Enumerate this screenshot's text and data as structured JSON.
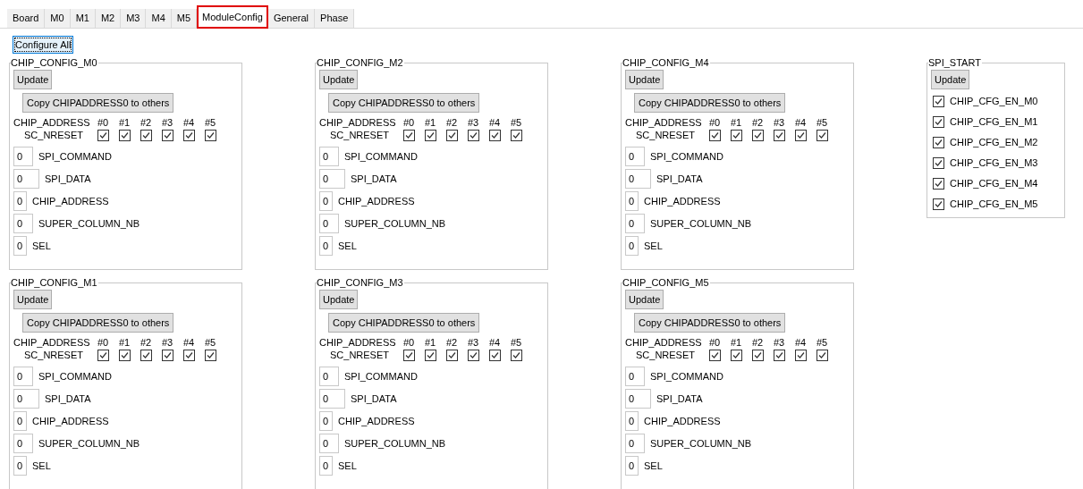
{
  "tabs": [
    {
      "label": "Board",
      "selected": false
    },
    {
      "label": "M0",
      "selected": false
    },
    {
      "label": "M1",
      "selected": false
    },
    {
      "label": "M2",
      "selected": false
    },
    {
      "label": "M3",
      "selected": false
    },
    {
      "label": "M4",
      "selected": false
    },
    {
      "label": "M5",
      "selected": false
    },
    {
      "label": "ModuleConfig",
      "selected": true
    },
    {
      "label": "General",
      "selected": false
    },
    {
      "label": "Phase",
      "selected": false
    }
  ],
  "configure_all": "Configure All",
  "groups": [
    {
      "title": "CHIP_CONFIG_M0",
      "update": "Update",
      "copy": "Copy CHIPADDRESS0 to others",
      "address_label": "CHIP_ADDRESS",
      "reset_label": "SC_NRESET",
      "chips": [
        {
          "label": "#0",
          "checked": true
        },
        {
          "label": "#1",
          "checked": true
        },
        {
          "label": "#2",
          "checked": true
        },
        {
          "label": "#3",
          "checked": true
        },
        {
          "label": "#4",
          "checked": true
        },
        {
          "label": "#5",
          "checked": true
        }
      ],
      "fields": [
        {
          "value": "0",
          "label": "SPI_COMMAND"
        },
        {
          "value": "0",
          "label": "SPI_DATA"
        },
        {
          "value": "0",
          "label": "CHIP_ADDRESS"
        },
        {
          "value": "0",
          "label": "SUPER_COLUMN_NB"
        },
        {
          "value": "0",
          "label": "SEL"
        }
      ]
    },
    {
      "title": "CHIP_CONFIG_M2",
      "update": "Update",
      "copy": "Copy CHIPADDRESS0 to others",
      "address_label": "CHIP_ADDRESS",
      "reset_label": "SC_NRESET",
      "chips": [
        {
          "label": "#0",
          "checked": true
        },
        {
          "label": "#1",
          "checked": true
        },
        {
          "label": "#2",
          "checked": true
        },
        {
          "label": "#3",
          "checked": true
        },
        {
          "label": "#4",
          "checked": true
        },
        {
          "label": "#5",
          "checked": true
        }
      ],
      "fields": [
        {
          "value": "0",
          "label": "SPI_COMMAND"
        },
        {
          "value": "0",
          "label": "SPI_DATA"
        },
        {
          "value": "0",
          "label": "CHIP_ADDRESS"
        },
        {
          "value": "0",
          "label": "SUPER_COLUMN_NB"
        },
        {
          "value": "0",
          "label": "SEL"
        }
      ]
    },
    {
      "title": "CHIP_CONFIG_M4",
      "update": "Update",
      "copy": "Copy CHIPADDRESS0 to others",
      "address_label": "CHIP_ADDRESS",
      "reset_label": "SC_NRESET",
      "chips": [
        {
          "label": "#0",
          "checked": true
        },
        {
          "label": "#1",
          "checked": true
        },
        {
          "label": "#2",
          "checked": true
        },
        {
          "label": "#3",
          "checked": true
        },
        {
          "label": "#4",
          "checked": true
        },
        {
          "label": "#5",
          "checked": true
        }
      ],
      "fields": [
        {
          "value": "0",
          "label": "SPI_COMMAND"
        },
        {
          "value": "0",
          "label": "SPI_DATA"
        },
        {
          "value": "0",
          "label": "CHIP_ADDRESS"
        },
        {
          "value": "0",
          "label": "SUPER_COLUMN_NB"
        },
        {
          "value": "0",
          "label": "SEL"
        }
      ]
    },
    {
      "title": "CHIP_CONFIG_M1",
      "update": "Update",
      "copy": "Copy CHIPADDRESS0 to others",
      "address_label": "CHIP_ADDRESS",
      "reset_label": "SC_NRESET",
      "chips": [
        {
          "label": "#0",
          "checked": true
        },
        {
          "label": "#1",
          "checked": true
        },
        {
          "label": "#2",
          "checked": true
        },
        {
          "label": "#3",
          "checked": true
        },
        {
          "label": "#4",
          "checked": true
        },
        {
          "label": "#5",
          "checked": true
        }
      ],
      "fields": [
        {
          "value": "0",
          "label": "SPI_COMMAND"
        },
        {
          "value": "0",
          "label": "SPI_DATA"
        },
        {
          "value": "0",
          "label": "CHIP_ADDRESS"
        },
        {
          "value": "0",
          "label": "SUPER_COLUMN_NB"
        },
        {
          "value": "0",
          "label": "SEL"
        }
      ]
    },
    {
      "title": "CHIP_CONFIG_M3",
      "update": "Update",
      "copy": "Copy CHIPADDRESS0 to others",
      "address_label": "CHIP_ADDRESS",
      "reset_label": "SC_NRESET",
      "chips": [
        {
          "label": "#0",
          "checked": true
        },
        {
          "label": "#1",
          "checked": true
        },
        {
          "label": "#2",
          "checked": true
        },
        {
          "label": "#3",
          "checked": true
        },
        {
          "label": "#4",
          "checked": true
        },
        {
          "label": "#5",
          "checked": true
        }
      ],
      "fields": [
        {
          "value": "0",
          "label": "SPI_COMMAND"
        },
        {
          "value": "0",
          "label": "SPI_DATA"
        },
        {
          "value": "0",
          "label": "CHIP_ADDRESS"
        },
        {
          "value": "0",
          "label": "SUPER_COLUMN_NB"
        },
        {
          "value": "0",
          "label": "SEL"
        }
      ]
    },
    {
      "title": "CHIP_CONFIG_M5",
      "update": "Update",
      "copy": "Copy CHIPADDRESS0 to others",
      "address_label": "CHIP_ADDRESS",
      "reset_label": "SC_NRESET",
      "chips": [
        {
          "label": "#0",
          "checked": true
        },
        {
          "label": "#1",
          "checked": true
        },
        {
          "label": "#2",
          "checked": true
        },
        {
          "label": "#3",
          "checked": true
        },
        {
          "label": "#4",
          "checked": true
        },
        {
          "label": "#5",
          "checked": true
        }
      ],
      "fields": [
        {
          "value": "0",
          "label": "SPI_COMMAND"
        },
        {
          "value": "0",
          "label": "SPI_DATA"
        },
        {
          "value": "0",
          "label": "CHIP_ADDRESS"
        },
        {
          "value": "0",
          "label": "SUPER_COLUMN_NB"
        },
        {
          "value": "0",
          "label": "SEL"
        }
      ]
    }
  ],
  "spi_start": {
    "title": "SPI_START",
    "update": "Update",
    "items": [
      {
        "label": "CHIP_CFG_EN_M0",
        "checked": true
      },
      {
        "label": "CHIP_CFG_EN_M1",
        "checked": true
      },
      {
        "label": "CHIP_CFG_EN_M2",
        "checked": true
      },
      {
        "label": "CHIP_CFG_EN_M3",
        "checked": true
      },
      {
        "label": "CHIP_CFG_EN_M4",
        "checked": true
      },
      {
        "label": "CHIP_CFG_EN_M5",
        "checked": true
      }
    ]
  }
}
